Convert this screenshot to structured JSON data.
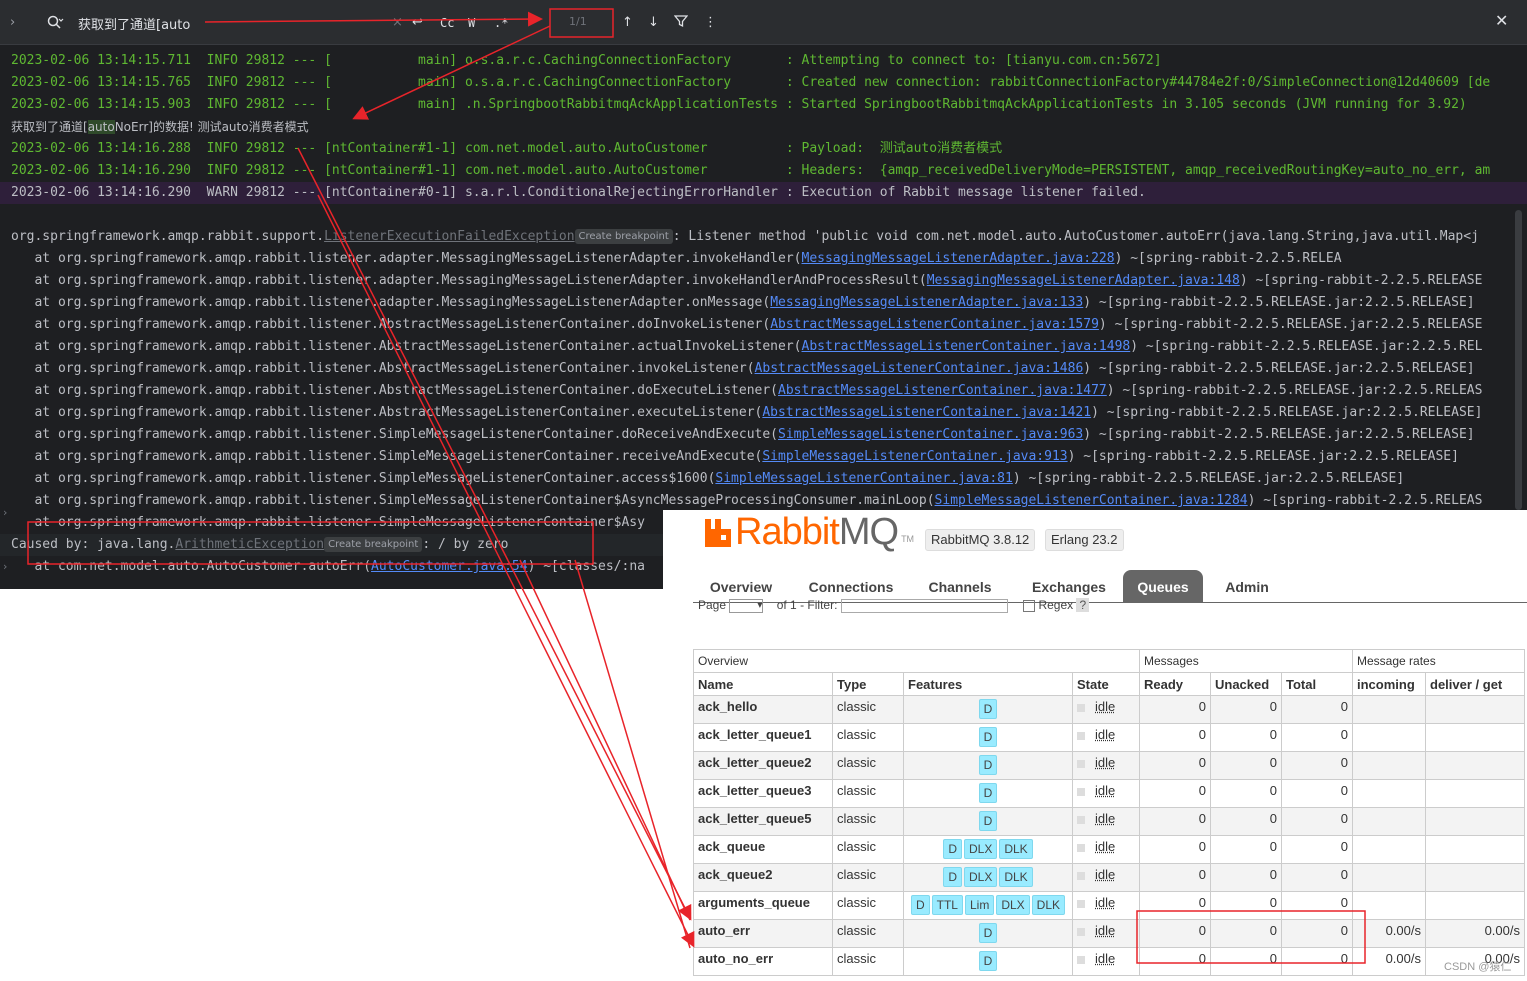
{
  "findbar": {
    "query": "获取到了通道[auto",
    "match_count": "1/1",
    "opt_case": "Cc",
    "opt_word": "W",
    "opt_regex": ".*"
  },
  "console": {
    "lines": [
      {
        "cls": "ok",
        "text": "2023-02-06 13:14:15.711  INFO 29812 --- [           main] o.s.a.r.c.CachingConnectionFactory       : Attempting to connect to: [tianyu.com.cn:5672]"
      },
      {
        "cls": "ok",
        "text": "2023-02-06 13:14:15.765  INFO 29812 --- [           main] o.s.a.r.c.CachingConnectionFactory       : Created new connection: rabbitConnectionFactory#44784e2f:0/SimpleConnection@12d40609 [de"
      },
      {
        "cls": "ok",
        "text": "2023-02-06 13:14:15.903  INFO 29812 --- [           main] .n.SpringbootRabbitmqAckApplicationTests : Started SpringbootRabbitmqAckApplicationTests in 3.105 seconds (JVM running for 3.92)"
      }
    ],
    "highlight_prefix": "获取到了通道[",
    "highlight_match": "auto",
    "highlight_suffix": "NoErr]的数据! 测试auto消费者模式",
    "info_lines": [
      {
        "text": "2023-02-06 13:14:16.288  INFO 29812 --- [ntContainer#1-1] com.net.model.auto.AutoCustomer          : Payload:  测试auto消费者模式"
      },
      {
        "text": "2023-02-06 13:14:16.290  INFO 29812 --- [ntContainer#1-1] com.net.model.auto.AutoCustomer          : Headers:  {amqp_receivedDeliveryMode=PERSISTENT, amqp_receivedRoutingKey=auto_no_err, am"
      }
    ],
    "warn_line": "2023-02-06 13:14:16.290  WARN 29812 --- [ntContainer#0-1] s.a.r.l.ConditionalRejectingErrorHandler : Execution of Rabbit message listener failed.",
    "exception": {
      "prefix": "org.springframework.amqp.rabbit.support.",
      "link": "ListenerExecutionFailedException",
      "chip": "Create breakpoint",
      "suffix": ": Listener method 'public void com.net.model.auto.AutoCustomer.autoErr(java.lang.String,java.util.Map<j"
    },
    "stack": [
      {
        "pre": "   at org.springframework.amqp.rabbit.listener.adapter.MessagingMessageListenerAdapter.invokeHandler(",
        "link": "MessagingMessageListenerAdapter.java:228",
        "post": ") ~[spring-rabbit-2.2.5.RELEA"
      },
      {
        "pre": "   at org.springframework.amqp.rabbit.listener.adapter.MessagingMessageListenerAdapter.invokeHandlerAndProcessResult(",
        "link": "MessagingMessageListenerAdapter.java:148",
        "post": ") ~[spring-rabbit-2.2.5.RELEASE"
      },
      {
        "pre": "   at org.springframework.amqp.rabbit.listener.adapter.MessagingMessageListenerAdapter.onMessage(",
        "link": "MessagingMessageListenerAdapter.java:133",
        "post": ") ~[spring-rabbit-2.2.5.RELEASE.jar:2.2.5.RELEASE]"
      },
      {
        "pre": "   at org.springframework.amqp.rabbit.listener.AbstractMessageListenerContainer.doInvokeListener(",
        "link": "AbstractMessageListenerContainer.java:1579",
        "post": ") ~[spring-rabbit-2.2.5.RELEASE.jar:2.2.5.RELEASE"
      },
      {
        "pre": "   at org.springframework.amqp.rabbit.listener.AbstractMessageListenerContainer.actualInvokeListener(",
        "link": "AbstractMessageListenerContainer.java:1498",
        "post": ") ~[spring-rabbit-2.2.5.RELEASE.jar:2.2.5.REL"
      },
      {
        "pre": "   at org.springframework.amqp.rabbit.listener.AbstractMessageListenerContainer.invokeListener(",
        "link": "AbstractMessageListenerContainer.java:1486",
        "post": ") ~[spring-rabbit-2.2.5.RELEASE.jar:2.2.5.RELEASE]"
      },
      {
        "pre": "   at org.springframework.amqp.rabbit.listener.AbstractMessageListenerContainer.doExecuteListener(",
        "link": "AbstractMessageListenerContainer.java:1477",
        "post": ") ~[spring-rabbit-2.2.5.RELEASE.jar:2.2.5.RELEAS"
      },
      {
        "pre": "   at org.springframework.amqp.rabbit.listener.AbstractMessageListenerContainer.executeListener(",
        "link": "AbstractMessageListenerContainer.java:1421",
        "post": ") ~[spring-rabbit-2.2.5.RELEASE.jar:2.2.5.RELEASE]"
      },
      {
        "pre": "   at org.springframework.amqp.rabbit.listener.SimpleMessageListenerContainer.doReceiveAndExecute(",
        "link": "SimpleMessageListenerContainer.java:963",
        "post": ") ~[spring-rabbit-2.2.5.RELEASE.jar:2.2.5.RELEASE]"
      },
      {
        "pre": "   at org.springframework.amqp.rabbit.listener.SimpleMessageListenerContainer.receiveAndExecute(",
        "link": "SimpleMessageListenerContainer.java:913",
        "post": ") ~[spring-rabbit-2.2.5.RELEASE.jar:2.2.5.RELEASE]"
      },
      {
        "pre": "   at org.springframework.amqp.rabbit.listener.SimpleMessageListenerContainer.access$1600(",
        "link": "SimpleMessageListenerContainer.java:81",
        "post": ") ~[spring-rabbit-2.2.5.RELEASE.jar:2.2.5.RELEASE]"
      },
      {
        "pre": "   at org.springframework.amqp.rabbit.listener.SimpleMessageListenerContainer$AsyncMessageProcessingConsumer.mainLoop(",
        "link": "SimpleMessageListenerContainer.java:1284",
        "post": ") ~[spring-rabbit-2.2.5.RELEAS"
      },
      {
        "pre": "   at org.springframework.amqp.rabbit.listener.SimpleMessageListenerContainer$Asy",
        "link": "",
        "post": ""
      }
    ],
    "caused_prefix": "Caused by: java.lang.",
    "caused_link": "ArithmeticException",
    "caused_chip": "Create breakpoint",
    "caused_suffix": ": / by zero",
    "last_pre": "   at com.net.model.auto.AutoCustomer.autoErr(",
    "last_link": "AutoCustomer.java:54",
    "last_post": ") ~[classes/:na"
  },
  "rabbitmq": {
    "logo_rabbit": "Rabbit",
    "logo_mq": "MQ",
    "logo_tm": "TM",
    "version": "RabbitMQ 3.8.12",
    "erlang": "Erlang 23.2",
    "tabs": [
      "Overview",
      "Connections",
      "Channels",
      "Exchanges",
      "Queues",
      "Admin"
    ],
    "active_tab": "Queues",
    "pager_page": "Page",
    "pager_of": "of 1",
    "pager_filter": "- Filter:",
    "regex_label": "Regex",
    "group_headers": [
      "Overview",
      "Messages",
      "Message rates"
    ],
    "columns": [
      "Name",
      "Type",
      "Features",
      "State",
      "Ready",
      "Unacked",
      "Total",
      "incoming",
      "deliver / get"
    ],
    "queues": [
      {
        "name": "ack_hello",
        "type": "classic",
        "features": [
          "D"
        ],
        "state": "idle",
        "ready": "0",
        "unacked": "0",
        "total": "0",
        "incoming": "",
        "deliver": ""
      },
      {
        "name": "ack_letter_queue1",
        "type": "classic",
        "features": [
          "D"
        ],
        "state": "idle",
        "ready": "0",
        "unacked": "0",
        "total": "0",
        "incoming": "",
        "deliver": ""
      },
      {
        "name": "ack_letter_queue2",
        "type": "classic",
        "features": [
          "D"
        ],
        "state": "idle",
        "ready": "0",
        "unacked": "0",
        "total": "0",
        "incoming": "",
        "deliver": ""
      },
      {
        "name": "ack_letter_queue3",
        "type": "classic",
        "features": [
          "D"
        ],
        "state": "idle",
        "ready": "0",
        "unacked": "0",
        "total": "0",
        "incoming": "",
        "deliver": ""
      },
      {
        "name": "ack_letter_queue5",
        "type": "classic",
        "features": [
          "D"
        ],
        "state": "idle",
        "ready": "0",
        "unacked": "0",
        "total": "0",
        "incoming": "",
        "deliver": ""
      },
      {
        "name": "ack_queue",
        "type": "classic",
        "features": [
          "D",
          "DLX",
          "DLK"
        ],
        "state": "idle",
        "ready": "0",
        "unacked": "0",
        "total": "0",
        "incoming": "",
        "deliver": ""
      },
      {
        "name": "ack_queue2",
        "type": "classic",
        "features": [
          "D",
          "DLX",
          "DLK"
        ],
        "state": "idle",
        "ready": "0",
        "unacked": "0",
        "total": "0",
        "incoming": "",
        "deliver": ""
      },
      {
        "name": "arguments_queue",
        "type": "classic",
        "features": [
          "D",
          "TTL",
          "Lim",
          "DLX",
          "DLK"
        ],
        "state": "idle",
        "ready": "0",
        "unacked": "0",
        "total": "0",
        "incoming": "",
        "deliver": ""
      },
      {
        "name": "auto_err",
        "type": "classic",
        "features": [
          "D"
        ],
        "state": "idle",
        "ready": "0",
        "unacked": "0",
        "total": "0",
        "incoming": "0.00/s",
        "deliver": "0.00/s"
      },
      {
        "name": "auto_no_err",
        "type": "classic",
        "features": [
          "D"
        ],
        "state": "idle",
        "ready": "0",
        "unacked": "0",
        "total": "0",
        "incoming": "0.00/s",
        "deliver": "0.00/s"
      }
    ]
  },
  "watermark": "CSDN @猿仁",
  "colors": {
    "annotation": "#e8242a",
    "console_green": "#5fb832",
    "link": "#548af7",
    "rabbit_orange": "#ff6600",
    "feature_badge": "#99ebff"
  }
}
